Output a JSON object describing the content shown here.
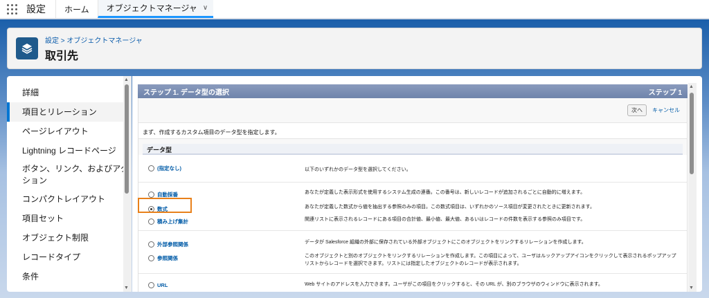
{
  "topnav": {
    "app_name": "設定",
    "tabs": [
      {
        "label": "ホーム"
      },
      {
        "label": "オブジェクトマネージャ"
      }
    ]
  },
  "header": {
    "breadcrumb": "設定 > オブジェクトマネージャ",
    "title": "取引先"
  },
  "sidebar": {
    "items": [
      {
        "label": "詳細"
      },
      {
        "label": "項目とリレーション"
      },
      {
        "label": "ページレイアウト"
      },
      {
        "label": "Lightning レコードページ"
      },
      {
        "label": "ボタン、リンク、およびアクション"
      },
      {
        "label": "コンパクトレイアウト"
      },
      {
        "label": "項目セット"
      },
      {
        "label": "オブジェクト制限"
      },
      {
        "label": "レコードタイプ"
      },
      {
        "label": "条件"
      }
    ]
  },
  "wizard": {
    "step_title": "ステップ 1. データ型の選択",
    "step_counter": "ステップ 1",
    "next_label": "次へ",
    "cancel_label": "キャンセル",
    "intro": "まず、作成するカスタム項目のデータ型を指定します。",
    "section_title": "データ型",
    "options": [
      {
        "label": "(指定なし)",
        "desc": "以下のいずれかのデータ型を選択してください。"
      },
      {
        "label": "自動採番",
        "desc": "あなたが定義した表示形式を使用するシステム生成の連番。この番号は、新しいレコードが追加されるごとに自動的に増えます。"
      },
      {
        "label": "数式",
        "desc": "あなたが定義した数式から値を抽出する参照のみの項目。この数式項目は、いずれかのソース項目が変更されたときに更新されます。"
      },
      {
        "label": "積み上げ集計",
        "desc": "関連リストに表示されるレコードにある項目の合計値、最小値、最大値、あるいはレコードの件数を表示する参照のみ項目です。"
      },
      {
        "label": "外部参照関係",
        "desc": "データが Salesforce 組織の外部に保存されている外部オブジェクトにこのオブジェクトをリンクするリレーションを作成します。"
      },
      {
        "label": "参照関係",
        "desc": "このオブジェクトと別のオブジェクトをリンクするリレーションを作成します。この項目によって、ユーザはルックアップアイコンをクリックして表示されるポップアップリストからレコードを選択できます。リストには指定したオブジェクトのレコードが表示されます。"
      },
      {
        "label": "URL",
        "desc": "Web サイトのアドレスを入力できます。ユーザがこの項目をクリックすると、その URL が、別のブラウザのウィンドウに表示されます。"
      }
    ],
    "selected_option": "数式"
  }
}
